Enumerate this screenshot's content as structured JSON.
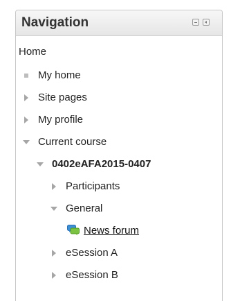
{
  "navigation": {
    "title": "Navigation",
    "home": "Home",
    "items": {
      "my_home": "My home",
      "site_pages": "Site pages",
      "my_profile": "My profile",
      "current_course": "Current course",
      "course_code": "0402eAFA2015-0407",
      "participants": "Participants",
      "general": "General",
      "news_forum": "News forum",
      "esession_a": "eSession A",
      "esession_b": "eSession B"
    }
  }
}
